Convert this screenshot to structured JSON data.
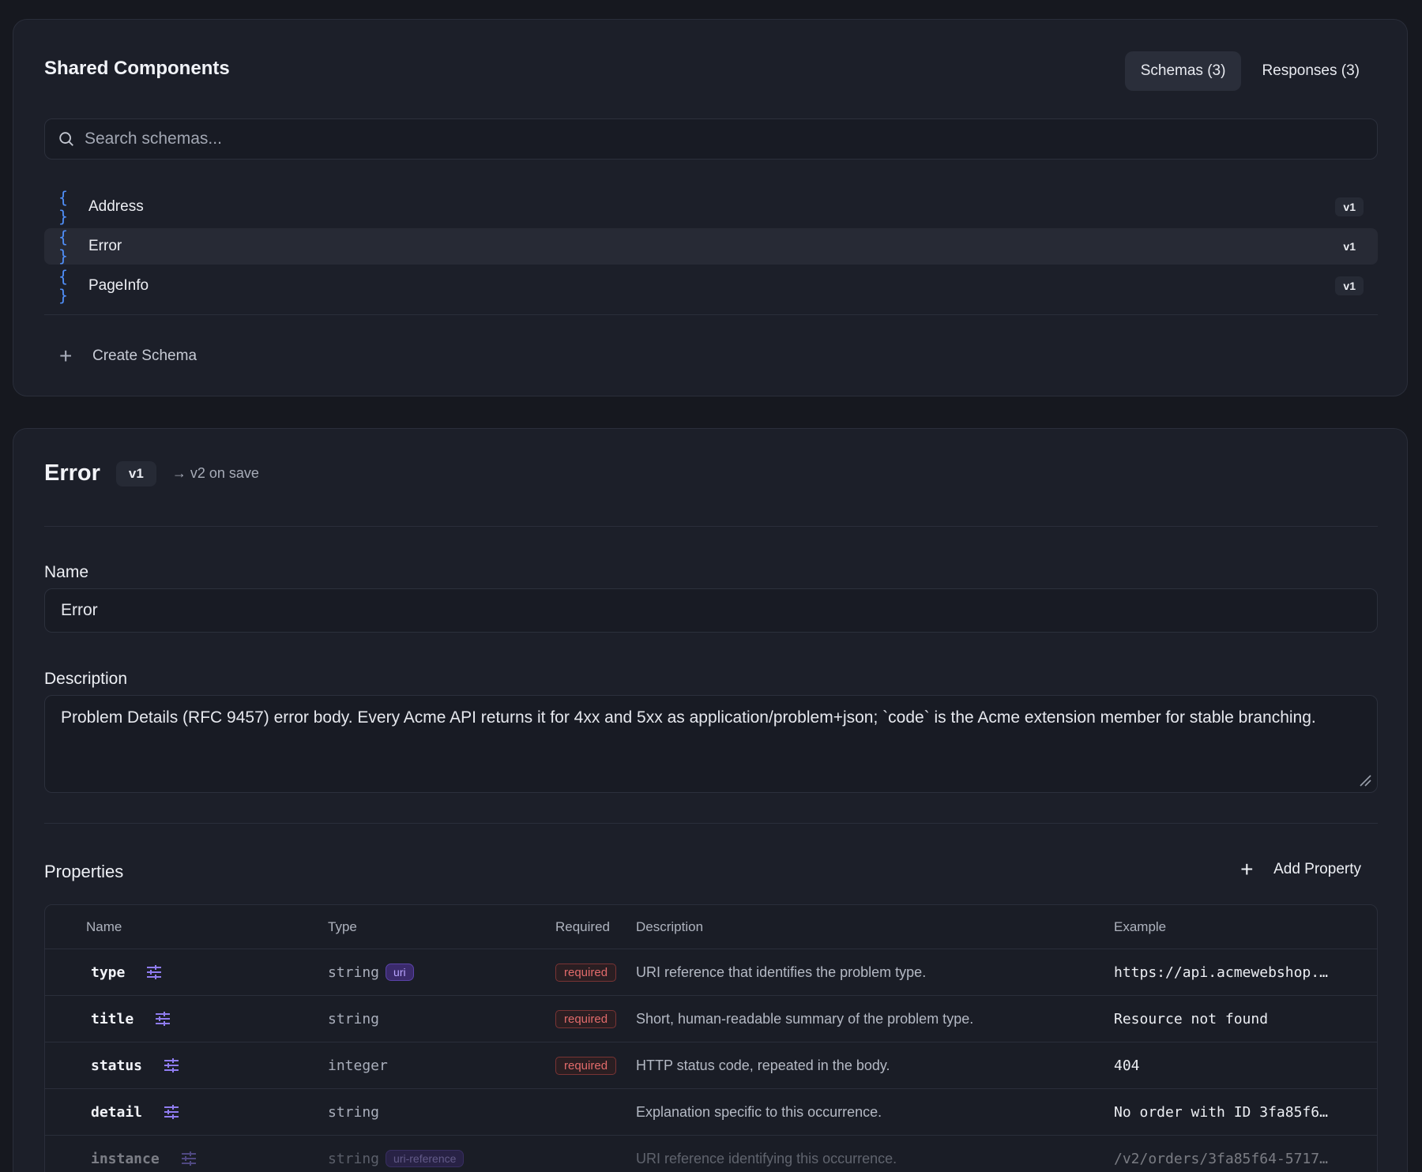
{
  "components": {
    "title": "Shared Components",
    "tabs": [
      {
        "label": "Schemas (3)",
        "active": true
      },
      {
        "label": "Responses (3)",
        "active": false
      }
    ],
    "search_placeholder": "Search schemas...",
    "schemas": [
      {
        "name": "Address",
        "version": "v1",
        "selected": false
      },
      {
        "name": "Error",
        "version": "v1",
        "selected": true
      },
      {
        "name": "PageInfo",
        "version": "v1",
        "selected": false
      }
    ],
    "braces_glyph": "{ }",
    "create_label": "Create Schema"
  },
  "detail": {
    "title": "Error",
    "version": "v1",
    "next_version": "→ v2 on save",
    "name_label": "Name",
    "name_value": "Error",
    "description_label": "Description",
    "description_value": "Problem Details (RFC 9457) error body. Every Acme API returns it for 4xx and 5xx as application/problem+json; `code` is the Acme extension member for stable branching.",
    "properties_title": "Properties",
    "add_property_label": "Add Property",
    "columns": {
      "name": "Name",
      "type": "Type",
      "required": "Required",
      "description": "Description",
      "example": "Example"
    },
    "properties": [
      {
        "name": "type",
        "type": "string",
        "format": "uri",
        "required": "required",
        "description": "URI reference that identifies the problem type.",
        "example": "https://api.acmewebshop.…"
      },
      {
        "name": "title",
        "type": "string",
        "format": "",
        "required": "required",
        "description": "Short, human-readable summary of the problem type.",
        "example": "Resource not found"
      },
      {
        "name": "status",
        "type": "integer",
        "format": "",
        "required": "required",
        "description": "HTTP status code, repeated in the body.",
        "example": "404"
      },
      {
        "name": "detail",
        "type": "string",
        "format": "",
        "required": "",
        "description": "Explanation specific to this occurrence.",
        "example": "No order with ID 3fa85f6…"
      },
      {
        "name": "instance",
        "type": "string",
        "format": "uri-reference",
        "required": "",
        "description": "URI reference identifying this occurrence.",
        "example": "/v2/orders/3fa85f64-5717…"
      }
    ]
  },
  "colors": {
    "background": "#16181f",
    "panel": "#1c1f29",
    "accent_blue": "#4f8ef7",
    "format_badge": "#b9a4ff",
    "required_badge": "#e26b6b"
  }
}
